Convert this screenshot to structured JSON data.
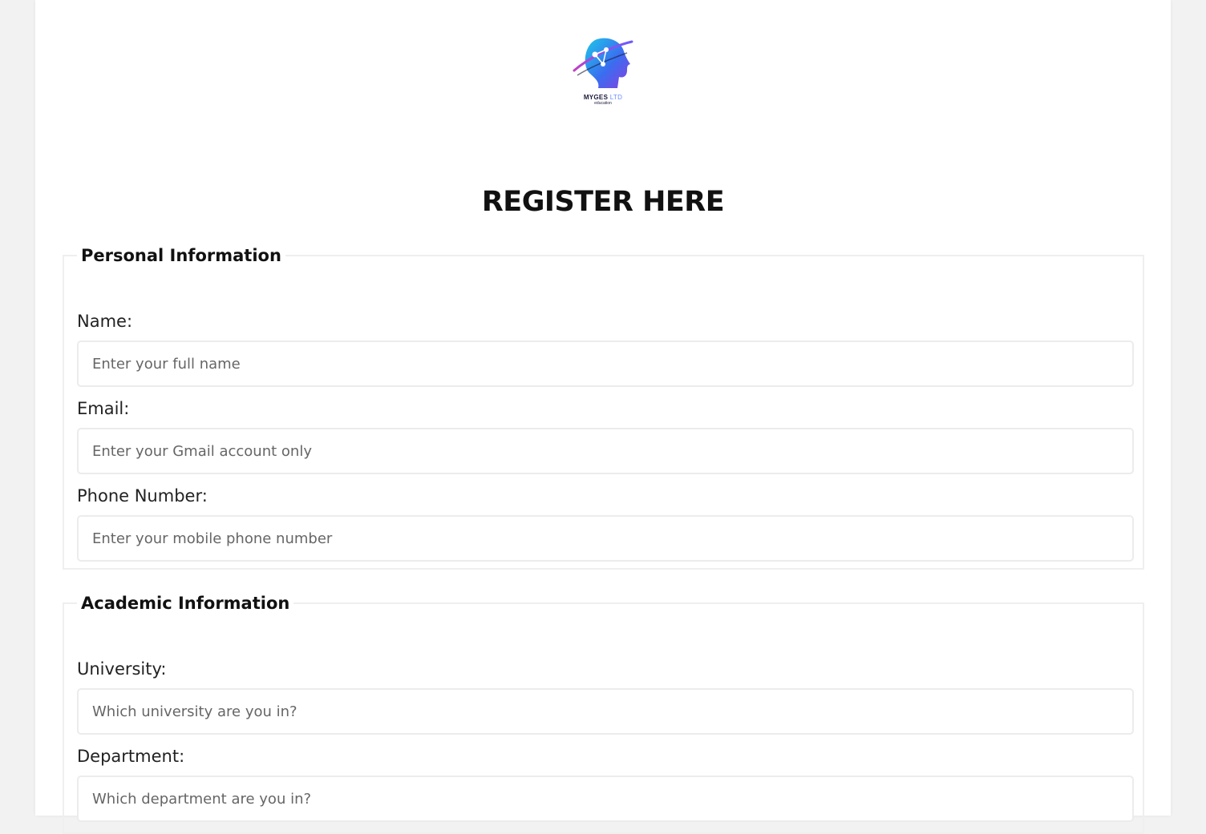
{
  "logo": {
    "icon": "brain-head-icon",
    "brand_main": "MYGES",
    "brand_accent": "LTD",
    "brand_sub": "education",
    "colors": {
      "cyan": "#1ec8e8",
      "blue": "#3a6df0",
      "purple": "#8a3fe0",
      "pink": "#c040c8"
    }
  },
  "page": {
    "title": "REGISTER HERE"
  },
  "personal": {
    "legend": "Personal Information",
    "name": {
      "label": "Name:",
      "placeholder": "Enter your full name",
      "value": ""
    },
    "email": {
      "label": "Email:",
      "placeholder": "Enter your Gmail account only",
      "value": ""
    },
    "phone": {
      "label": "Phone Number:",
      "placeholder": "Enter your mobile phone number",
      "value": ""
    }
  },
  "academic": {
    "legend": "Academic Information",
    "university": {
      "label": "University:",
      "placeholder": "Which university are you in?",
      "value": ""
    },
    "department": {
      "label": "Department:",
      "placeholder": "Which department are you in?",
      "value": ""
    }
  },
  "theme": {
    "page_bg": "#f2f2f2",
    "card_bg": "#ffffff",
    "border": "#ececec"
  }
}
